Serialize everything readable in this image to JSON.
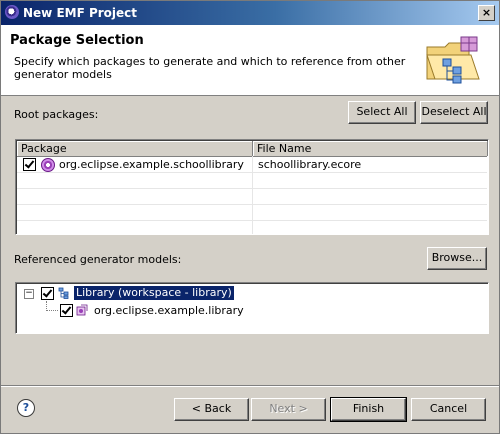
{
  "window": {
    "title": "New EMF Project",
    "close_label": "×"
  },
  "header": {
    "title": "Package Selection",
    "description": "Specify which packages to generate and which to reference from other generator models"
  },
  "root_packages": {
    "label": "Root packages:",
    "select_all": "Select All",
    "deselect_all": "Deselect All",
    "columns": [
      "Package",
      "File Name"
    ],
    "rows": [
      {
        "checked": true,
        "package": "org.eclipse.example.schoollibrary",
        "file": "schoollibrary.ecore"
      }
    ]
  },
  "referenced": {
    "label": "Referenced generator models:",
    "browse": "Browse...",
    "tree": [
      {
        "expanded": true,
        "checked": true,
        "label": "Library (workspace - library)",
        "selected": true,
        "children": [
          {
            "checked": true,
            "label": "org.eclipse.example.library"
          }
        ]
      }
    ]
  },
  "footer": {
    "help_glyph": "?",
    "back": "< Back",
    "next": "Next >",
    "finish": "Finish",
    "cancel": "Cancel"
  }
}
